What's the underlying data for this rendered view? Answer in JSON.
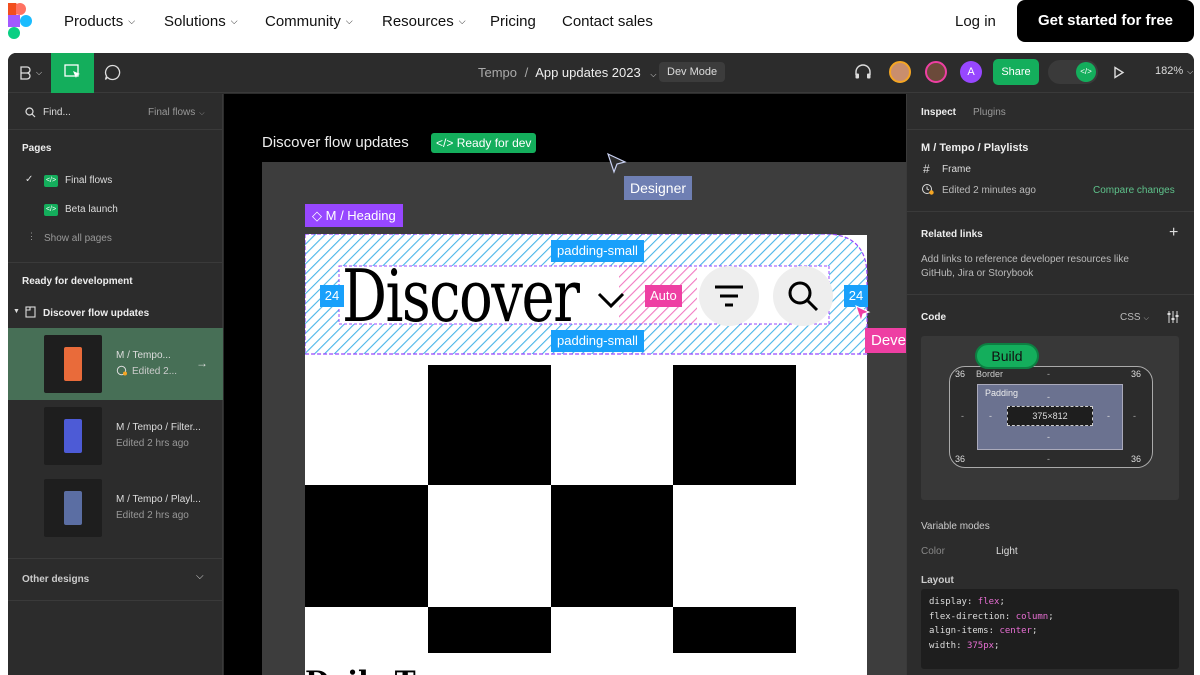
{
  "topnav": {
    "items": [
      {
        "label": "Products",
        "dropdown": true
      },
      {
        "label": "Solutions",
        "dropdown": true
      },
      {
        "label": "Community",
        "dropdown": true
      },
      {
        "label": "Resources",
        "dropdown": true
      },
      {
        "label": "Pricing",
        "dropdown": false
      },
      {
        "label": "Contact sales",
        "dropdown": false
      }
    ],
    "login": "Log in",
    "cta": "Get started for free"
  },
  "toolbar": {
    "project": "Tempo",
    "separator": "/",
    "file": "App updates 2023",
    "devmode": "Dev Mode",
    "share": "Share",
    "zoom": "182%",
    "avatar_initial": "A"
  },
  "left": {
    "search_placeholder": "Find...",
    "filter": "Final flows",
    "pages_heading": "Pages",
    "pages": [
      "Final flows",
      "Beta launch"
    ],
    "show_all": "Show all pages",
    "ready_heading": "Ready for development",
    "section": "Discover flow updates",
    "flows": [
      {
        "title": "M / Tempo...",
        "meta": "Edited 2..."
      },
      {
        "title": "M / Tempo / Filter...",
        "meta": "Edited 2 hrs ago"
      },
      {
        "title": "M / Tempo / Playl...",
        "meta": "Edited 2 hrs ago"
      }
    ],
    "other": "Other designs"
  },
  "canvas": {
    "frame_title": "Discover flow updates",
    "ready_badge": "Ready for dev",
    "designer": "Designer",
    "developer": "Developer",
    "component": "M / Heading",
    "padding_top": "padding-small",
    "padding_bottom": "padding-small",
    "left_pad": "24",
    "right_pad": "24",
    "auto": "Auto",
    "heading": "Discover",
    "bottom_text": "Daily T..."
  },
  "right": {
    "tabs": [
      "Inspect",
      "Plugins"
    ],
    "frame_path": "M / Tempo / Playlists",
    "frame_type": "Frame",
    "edited": "Edited 2 minutes ago",
    "compare": "Compare changes",
    "related_heading": "Related links",
    "related_desc_1": "Add links to reference developer resources like",
    "related_desc_2": "GitHub, Jira or Storybook",
    "code_heading": "Code",
    "code_lang": "CSS",
    "build": "Build",
    "box": {
      "border_label": "Border",
      "padding_label": "Padding",
      "size": "375×812",
      "corner_value": "36",
      "dash": "-"
    },
    "variable_modes": "Variable modes",
    "color_label": "Color",
    "color_value": "Light",
    "layout_heading": "Layout",
    "css": [
      {
        "prop": "display",
        "value": "flex"
      },
      {
        "prop": "flex-direction",
        "value": "column"
      },
      {
        "prop": "align-items",
        "value": "center"
      },
      {
        "prop": "width",
        "value": "375px"
      }
    ]
  },
  "colors": {
    "accent_green": "#14ae5c",
    "purple_component": "#9747ff",
    "blue_spec": "#18a0fb",
    "pink_dev": "#ee3fa3",
    "designer_tag": "#6f7fb3"
  }
}
